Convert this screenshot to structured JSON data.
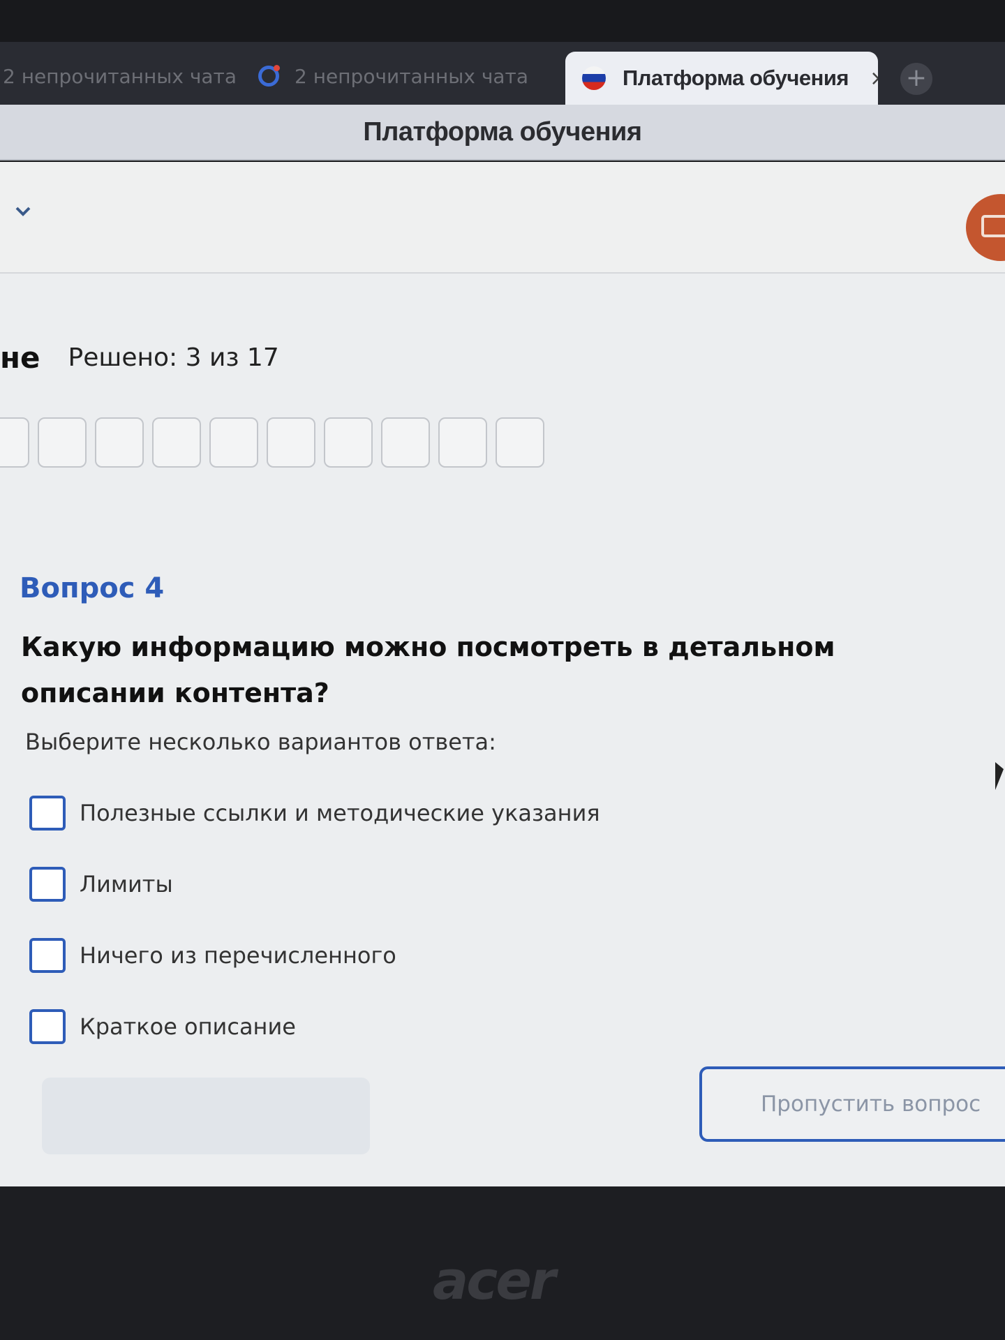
{
  "tabs": [
    {
      "label": "2 непрочитанных чата"
    },
    {
      "label": "2 непрочитанных чата"
    },
    {
      "label": "Платформа обучения",
      "close": "×"
    }
  ],
  "new_tab": "+",
  "window_title": "Платформа обучения",
  "status": {
    "heading_fragment": "не",
    "solved": "Решено: 3 из 17"
  },
  "question": {
    "label": "Вопрос 4",
    "text": "Какую информацию можно посмотреть в детальном описании контента?",
    "hint": "Выберите несколько вариантов ответа:",
    "options": [
      {
        "label": "Полезные ссылки и методические указания",
        "checked": false
      },
      {
        "label": "Лимиты",
        "checked": false
      },
      {
        "label": "Ничего из перечисленного",
        "checked": false
      },
      {
        "label": "Краткое описание",
        "checked": false
      }
    ]
  },
  "buttons": {
    "answer": "",
    "skip": "Пропустить вопрос"
  },
  "colors": {
    "accent": "#2e5cb8",
    "orange": "#c4562f"
  },
  "laptop_brand": "acer"
}
